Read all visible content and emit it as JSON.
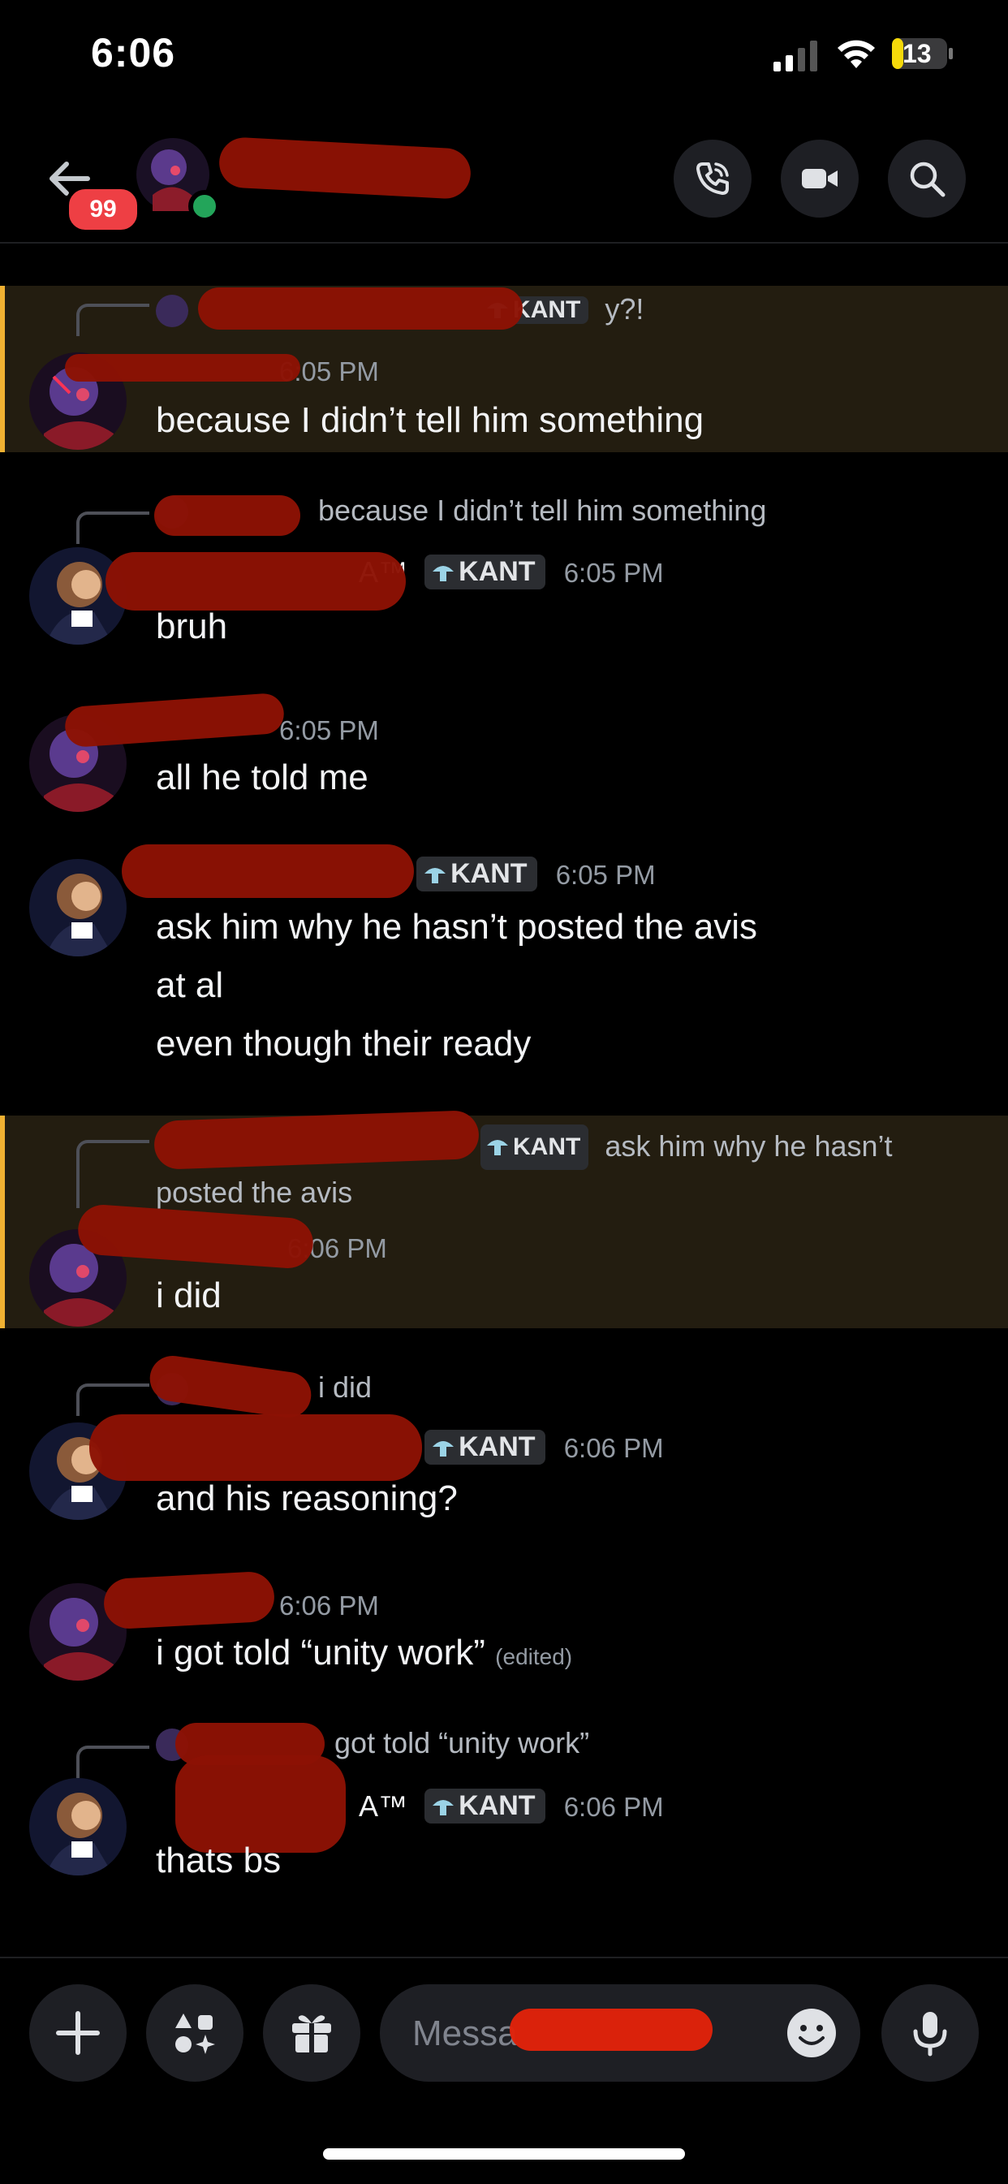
{
  "status_bar": {
    "time": "6:06",
    "battery": "13"
  },
  "header": {
    "unread_badge": "99"
  },
  "role_tag": "KANT",
  "messages": [
    {
      "reply_text": "y?!",
      "timestamp": "6:05 PM",
      "lines": [
        "because I didn’t tell him something"
      ],
      "mention": true
    },
    {
      "reply_text": "because I didn’t tell him something",
      "name_suffix": "A™",
      "timestamp": "6:05 PM",
      "lines": [
        "bruh"
      ]
    },
    {
      "timestamp": "6:05 PM",
      "lines": [
        "all he told me"
      ]
    },
    {
      "timestamp": "6:05 PM",
      "lines": [
        "ask him why he hasn’t posted the avis",
        "at al",
        "even though their ready"
      ]
    },
    {
      "reply_text": "ask him why he hasn’t",
      "reply_text_2": "posted the avis",
      "timestamp": "6:06 PM",
      "lines": [
        "i did"
      ],
      "mention": true
    },
    {
      "reply_text": "i did",
      "timestamp": "6:06 PM",
      "lines": [
        "and his reasoning?"
      ]
    },
    {
      "timestamp": "6:06 PM",
      "lines": [
        "i got told “unity work”"
      ],
      "edited": "(edited)"
    },
    {
      "reply_text": "got told “unity work”",
      "name_suffix": "A™",
      "timestamp": "6:06 PM",
      "lines": [
        "thats bs"
      ]
    }
  ],
  "composer": {
    "placeholder": "Messa"
  },
  "icons": [
    "back-arrow-icon",
    "phone-icon",
    "video-icon",
    "search-icon",
    "plus-icon",
    "apps-icon",
    "gift-icon",
    "emoji-icon",
    "microphone-icon"
  ]
}
